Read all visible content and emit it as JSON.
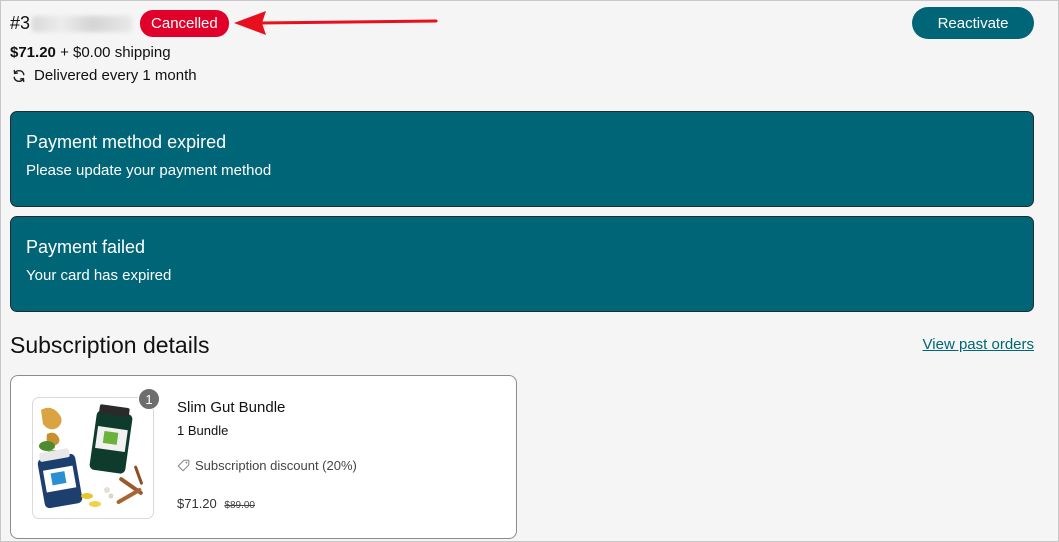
{
  "order": {
    "number_visible": "#3",
    "status": "Cancelled",
    "reactivate_label": "Reactivate"
  },
  "pricing": {
    "price": "$71.20",
    "shipping": "+ $0.00 shipping"
  },
  "delivery": {
    "text": "Delivered every 1 month",
    "icon": "refresh-icon"
  },
  "alerts": [
    {
      "title": "Payment method expired",
      "text": "Please update your payment method"
    },
    {
      "title": "Payment failed",
      "text": "Your card has expired"
    }
  ],
  "details": {
    "title": "Subscription details",
    "past_orders_link": "View past orders"
  },
  "product": {
    "quantity": "1",
    "name": "Slim Gut Bundle",
    "variant": "1 Bundle",
    "discount": "Subscription discount (20%)",
    "discount_icon": "tag-icon",
    "price": "$71.20",
    "compare_price": "$89.00"
  },
  "colors": {
    "accent": "#006677",
    "status_cancelled": "#e0002a",
    "annotation_arrow": "#e8101c"
  }
}
